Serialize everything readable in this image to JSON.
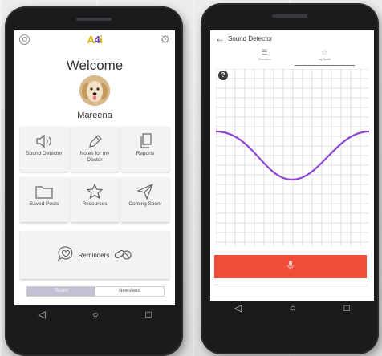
{
  "left_phone": {
    "app_logo": {
      "a": "A",
      "four": "4",
      "i": "i"
    },
    "welcome": "Welcome",
    "user_name": "Mareena",
    "tiles": [
      {
        "label": "Sound Detector",
        "icon": "speaker-icon"
      },
      {
        "label": "Notes for my Doctor",
        "icon": "pencil-icon"
      },
      {
        "label": "Reports",
        "icon": "copy-icon"
      },
      {
        "label": "Saved Posts",
        "icon": "folder-icon"
      },
      {
        "label": "Resources",
        "icon": "star-icon"
      },
      {
        "label": "Coming Soon!",
        "icon": "send-icon"
      }
    ],
    "reminders": {
      "label": "Reminders",
      "icons": [
        "heart-chat-icon",
        "pills-icon"
      ]
    },
    "tabs": [
      {
        "label": "Toolkit",
        "active": true
      },
      {
        "label": "Newsfeed",
        "active": false
      }
    ]
  },
  "right_phone": {
    "title": "Sound Detector",
    "subtabs": [
      {
        "label": "Simulator",
        "icon": "list-icon",
        "active": false
      },
      {
        "label": "my Toolkit",
        "icon": "star-icon",
        "active": true
      }
    ],
    "help_mark": "?",
    "record_button_color": "#ef4d3a"
  },
  "colors": {
    "accent_purple": "#8e44d6",
    "tab_active": "#c5bfd3",
    "logo_yellow": "#e2b400",
    "logo_purple": "#6b3fa0"
  }
}
